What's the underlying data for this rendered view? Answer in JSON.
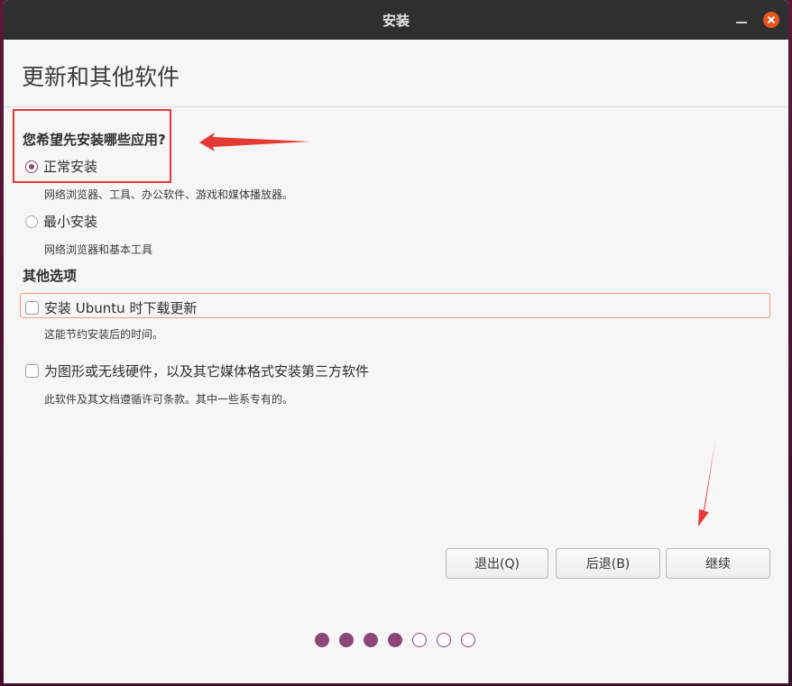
{
  "window": {
    "title": "安装"
  },
  "page": {
    "title": "更新和其他软件"
  },
  "apps_section": {
    "question": "您希望先安装哪些应用?",
    "options": [
      {
        "label": "正常安装",
        "description": "网络浏览器、工具、办公软件、游戏和媒体播放器。",
        "selected": true
      },
      {
        "label": "最小安装",
        "description": "网络浏览器和基本工具",
        "selected": false
      }
    ]
  },
  "other_section": {
    "heading": "其他选项",
    "options": [
      {
        "label": "安装 Ubuntu 时下载更新",
        "description": "这能节约安装后的时间。",
        "checked": false
      },
      {
        "label": "为图形或无线硬件，以及其它媒体格式安装第三方软件",
        "description": "此软件及其文档遵循许可条款。其中一些系专有的。",
        "checked": false
      }
    ]
  },
  "buttons": {
    "quit": "退出(Q)",
    "back": "后退(B)",
    "continue": "继续"
  },
  "progress": {
    "completed_steps": 4,
    "total_steps": 7
  },
  "colors": {
    "accent": "#8a4778",
    "close_button": "#e95420",
    "annotation": "#e53935"
  }
}
